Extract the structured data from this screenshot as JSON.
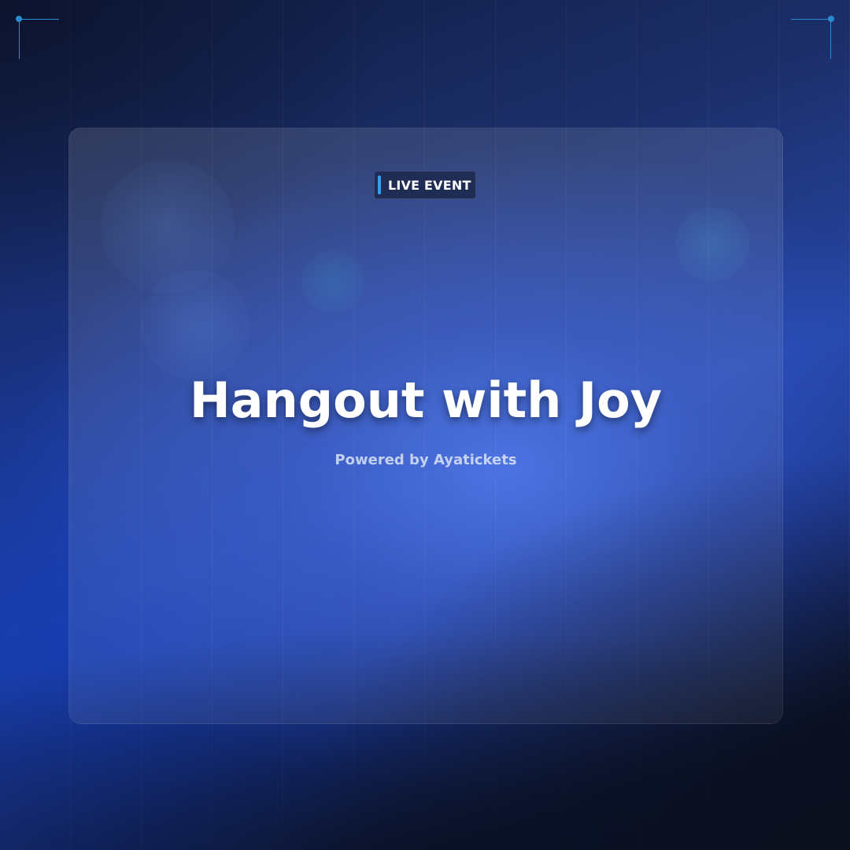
{
  "badge": {
    "label": "LIVE EVENT"
  },
  "event": {
    "title": "Hangout with Joy",
    "subtitle": "Powered by Ayatickets"
  },
  "colors": {
    "accent": "#2fa0f0",
    "corner_accent": "#2a8bd0",
    "badge_background": "#1f2d55"
  }
}
